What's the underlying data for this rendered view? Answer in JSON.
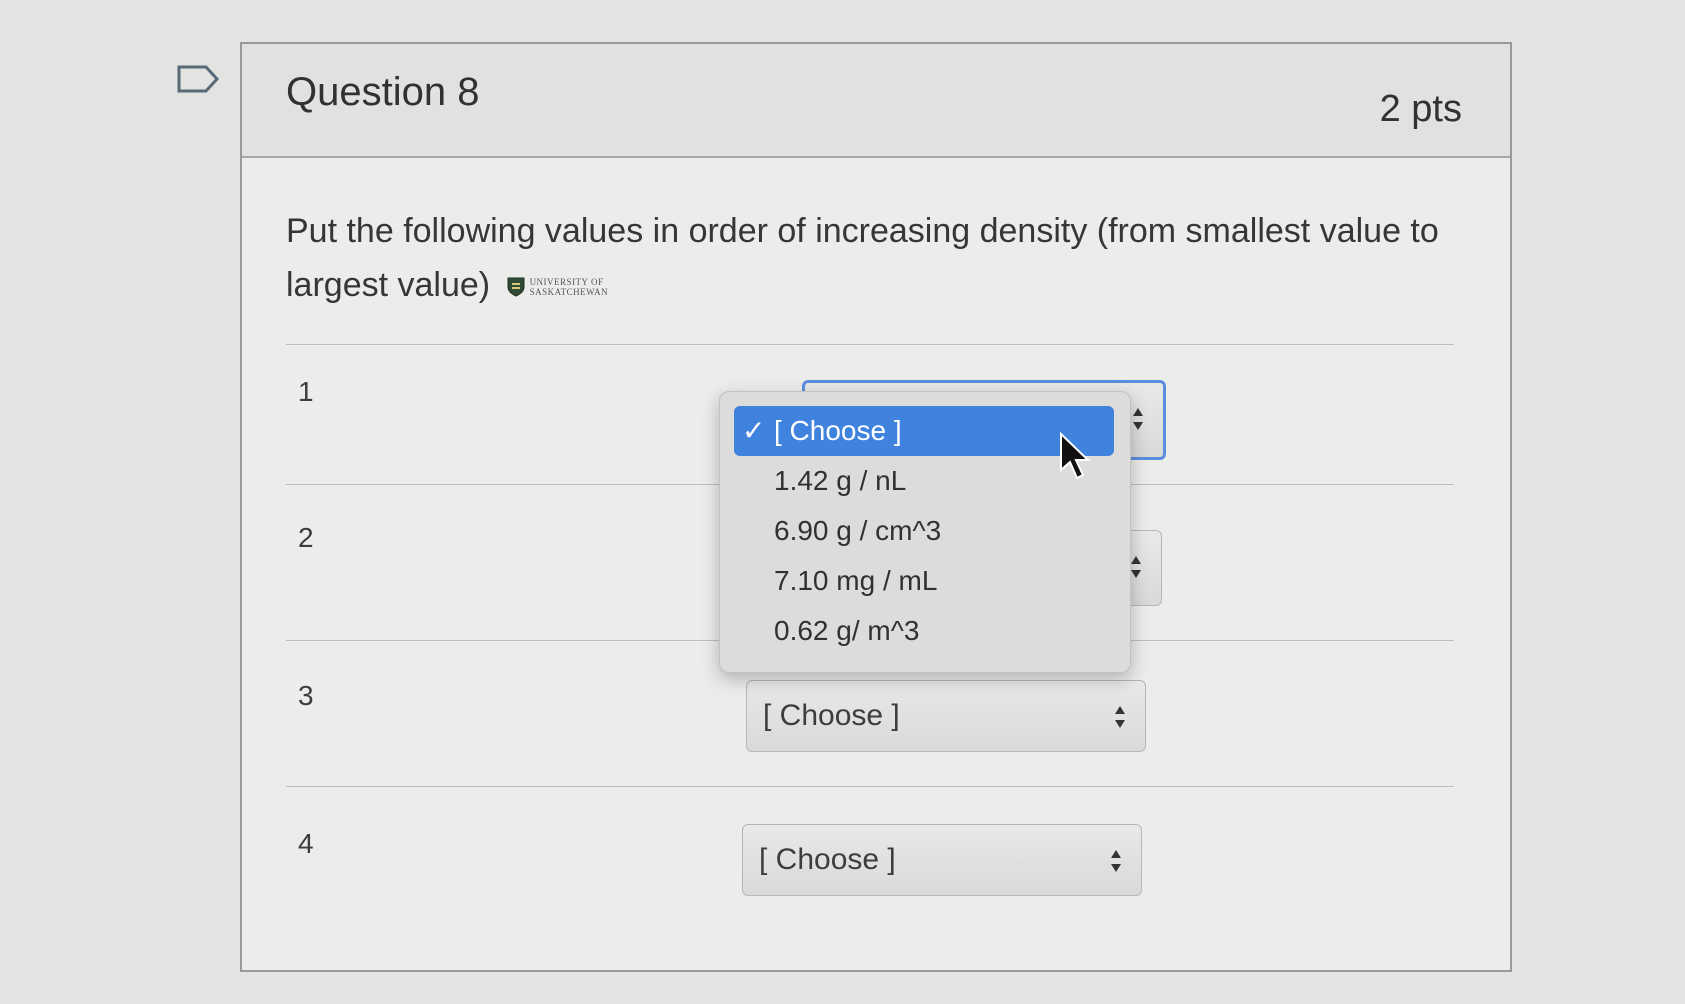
{
  "question": {
    "title": "Question 8",
    "points": "2 pts",
    "prompt": "Put the following values in order of increasing density (from smallest value to largest value)",
    "logo_text_line1": "UNIVERSITY OF",
    "logo_text_line2": "SASKATCHEWAN"
  },
  "rows": [
    {
      "number": "1",
      "value": "[ Choose ]"
    },
    {
      "number": "2",
      "value": "[ Choose ]"
    },
    {
      "number": "3",
      "value": "[ Choose ]"
    },
    {
      "number": "4",
      "value": "[ Choose ]"
    }
  ],
  "dropdown": {
    "selected_mark": "✓",
    "options": [
      "[ Choose ]",
      "1.42 g / nL",
      "6.90 g / cm^3",
      "7.10 mg / mL",
      "0.62 g/ m^3"
    ],
    "selected_index": 0
  },
  "colors": {
    "accent": "#3f83df",
    "focus_ring": "#5b8ede"
  }
}
